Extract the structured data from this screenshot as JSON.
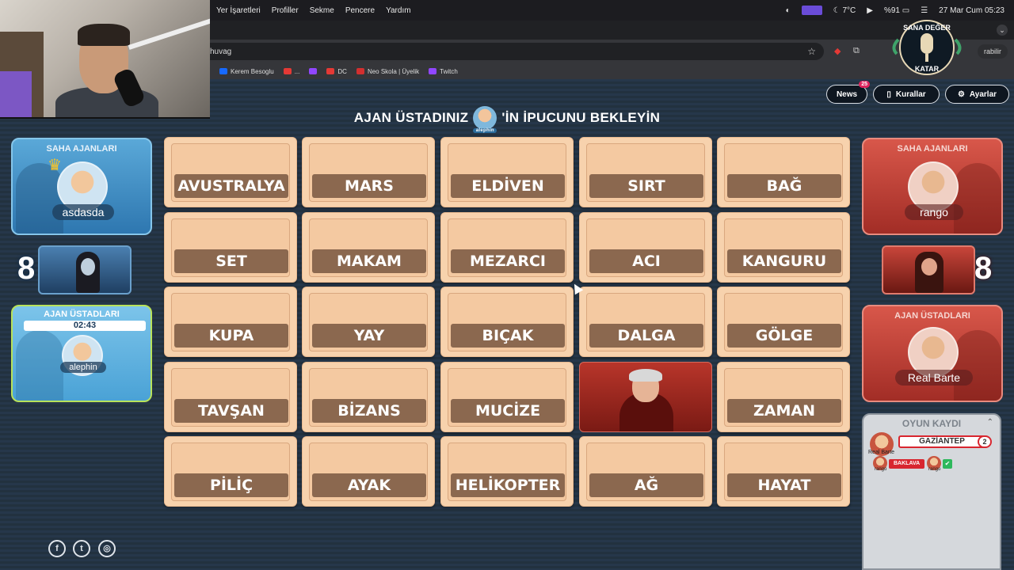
{
  "menubar": {
    "items": [
      "Yer İşaretleri",
      "Profiller",
      "Sekme",
      "Pencere",
      "Yardım"
    ],
    "temperature": "7°C",
    "battery": "%91",
    "datetime": "27 Mar Cum  05:23"
  },
  "browser": {
    "url": "huvag",
    "update_label": "rabilir",
    "bookmarks": [
      {
        "label": "Kerem Besoglu",
        "color": "#1769ff"
      },
      {
        "label": "...",
        "color": "#e53935"
      },
      {
        "label": "",
        "color": "#9146ff"
      },
      {
        "label": "DC",
        "color": "#e53935"
      },
      {
        "label": "Neo Skola | Üyelik",
        "color": "#d32f2f"
      },
      {
        "label": "Twitch",
        "color": "#9146ff"
      }
    ]
  },
  "logo": {
    "top_text": "SANA DEĞER",
    "bottom_text": "KATAR"
  },
  "top_buttons": {
    "news_label": "News",
    "news_badge": "25",
    "rules_label": "Kurallar",
    "settings_label": "Ayarlar"
  },
  "header": {
    "prefix": "AJAN ÜSTADINIZ",
    "avatar_name": "alephin",
    "suffix": "'İN İPUCUNU BEKLEYİN"
  },
  "blue_team": {
    "color": "#3a8cc6",
    "operatives_title": "SAHA AJANLARI",
    "operative_name": "asdasda",
    "score": "8",
    "spymasters_title": "AJAN ÜSTADLARI",
    "timer": "02:43",
    "spymaster_name": "alephin"
  },
  "red_team": {
    "color": "#c2392f",
    "operatives_title": "SAHA AJANLARI",
    "operative_name": "rango",
    "score": "8",
    "spymasters_title": "AJAN ÜSTADLARI",
    "spymaster_name": "Real Barte"
  },
  "board": {
    "cards": [
      "AVUSTRALYA",
      "MARS",
      "ELDİVEN",
      "SIRT",
      "BAĞ",
      "SET",
      "MAKAM",
      "MEZARCI",
      "ACI",
      "KANGURU",
      "KUPA",
      "YAY",
      "BIÇAK",
      "DALGA",
      "GÖLGE",
      "TAVŞAN",
      "BİZANS",
      "MUCİZE",
      "",
      "ZAMAN",
      "PİLİÇ",
      "AYAK",
      "HELİKOPTER",
      "AĞ",
      "HAYAT"
    ],
    "revealed_index": 18,
    "revealed_team": "red"
  },
  "game_log": {
    "title": "OYUN KAYDI",
    "spymaster": "Real Barte",
    "clue_word": "GAZİANTEP",
    "clue_number": "2",
    "guesser": "rango",
    "guess_word": "BAKLAVA",
    "guess_result": "✔"
  },
  "social": [
    "facebook-icon",
    "twitter-icon",
    "instagram-icon"
  ]
}
